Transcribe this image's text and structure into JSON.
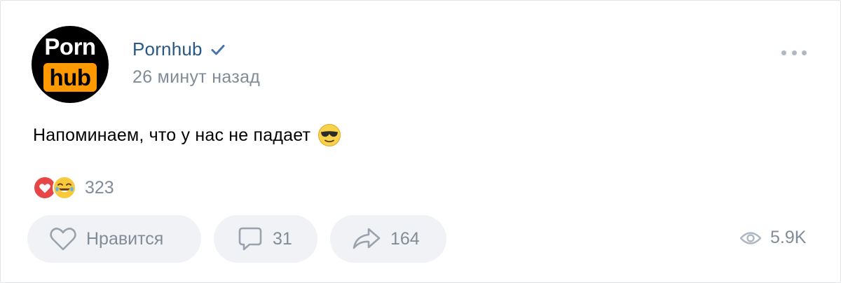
{
  "post": {
    "author": {
      "logo_top": "Porn",
      "logo_bottom": "hub",
      "name": "Pornhub"
    },
    "time": "26 минут назад",
    "text": "Напоминаем, что у нас не падает",
    "reactions": {
      "icons": [
        "heart-reaction-icon",
        "laughing-reaction-icon"
      ],
      "count": "323"
    },
    "actions": {
      "like_label": "Нравится",
      "comments_count": "31",
      "shares_count": "164"
    },
    "views": "5.9K"
  },
  "colors": {
    "author_link": "#2a5885",
    "muted": "#818c99",
    "button_bg": "#f0f2f5",
    "logo_accent": "#ff9900",
    "verified": "#4a76a8"
  }
}
